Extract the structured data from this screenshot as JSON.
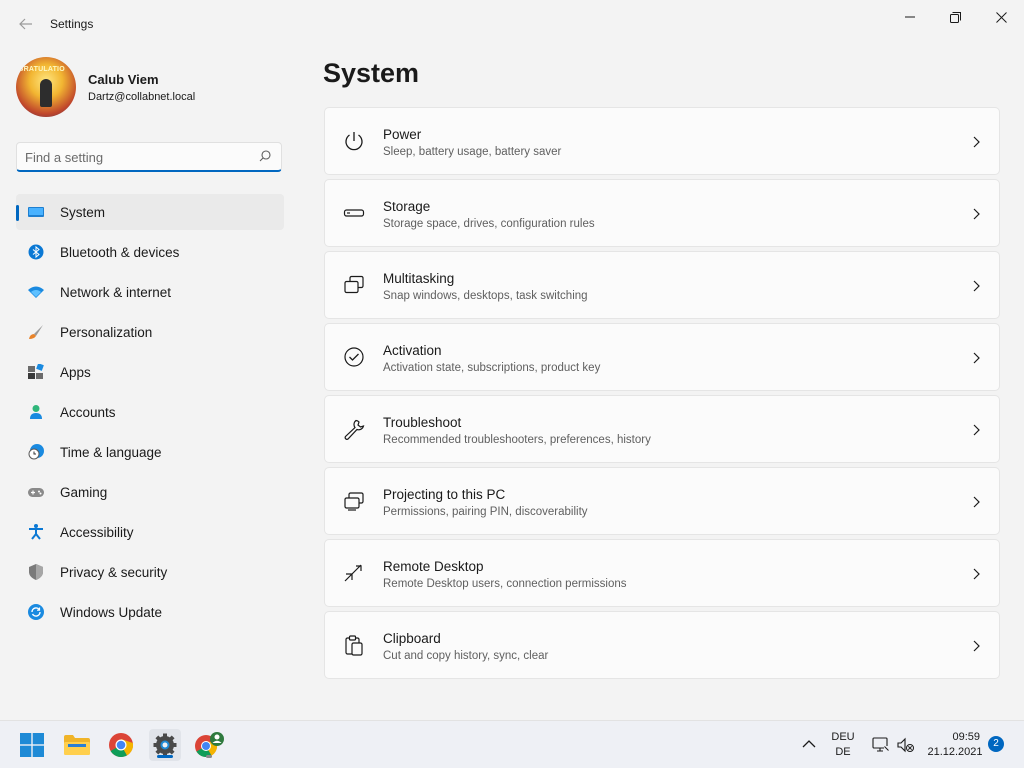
{
  "window": {
    "app_title": "Settings"
  },
  "profile": {
    "name": "Calub Viem",
    "email": "Dartz@collabnet.local",
    "avatar_text": "GRATULATIO"
  },
  "search": {
    "placeholder": "Find a setting",
    "value": ""
  },
  "sidebar": {
    "items": [
      {
        "label": "System",
        "icon": "system-icon",
        "active": true
      },
      {
        "label": "Bluetooth & devices",
        "icon": "bluetooth-icon"
      },
      {
        "label": "Network & internet",
        "icon": "wifi-icon"
      },
      {
        "label": "Personalization",
        "icon": "brush-icon"
      },
      {
        "label": "Apps",
        "icon": "apps-icon"
      },
      {
        "label": "Accounts",
        "icon": "person-icon"
      },
      {
        "label": "Time & language",
        "icon": "clock-globe-icon"
      },
      {
        "label": "Gaming",
        "icon": "gamepad-icon"
      },
      {
        "label": "Accessibility",
        "icon": "accessibility-icon"
      },
      {
        "label": "Privacy & security",
        "icon": "shield-icon"
      },
      {
        "label": "Windows Update",
        "icon": "update-icon"
      }
    ]
  },
  "main": {
    "title": "System",
    "cards": [
      {
        "title": "Power",
        "subtitle": "Sleep, battery usage, battery saver",
        "icon": "power-icon"
      },
      {
        "title": "Storage",
        "subtitle": "Storage space, drives, configuration rules",
        "icon": "storage-icon"
      },
      {
        "title": "Multitasking",
        "subtitle": "Snap windows, desktops, task switching",
        "icon": "multitasking-icon"
      },
      {
        "title": "Activation",
        "subtitle": "Activation state, subscriptions, product key",
        "icon": "activation-check-icon"
      },
      {
        "title": "Troubleshoot",
        "subtitle": "Recommended troubleshooters, preferences, history",
        "icon": "wrench-icon"
      },
      {
        "title": "Projecting to this PC",
        "subtitle": "Permissions, pairing PIN, discoverability",
        "icon": "projecting-icon"
      },
      {
        "title": "Remote Desktop",
        "subtitle": "Remote Desktop users, connection permissions",
        "icon": "remote-desktop-icon"
      },
      {
        "title": "Clipboard",
        "subtitle": "Cut and copy history, sync, clear",
        "icon": "clipboard-icon"
      }
    ]
  },
  "taskbar": {
    "apps": [
      {
        "name": "start",
        "icon": "windows-start-icon"
      },
      {
        "name": "file-explorer",
        "icon": "folder-icon"
      },
      {
        "name": "chrome",
        "icon": "chrome-icon"
      },
      {
        "name": "settings",
        "icon": "settings-gear-icon",
        "active": true
      },
      {
        "name": "chrome-profile",
        "icon": "chrome-profile-icon"
      }
    ],
    "language_line1": "DEU",
    "language_line2": "DE",
    "time": "09:59",
    "date": "21.12.2021",
    "notification_count": "2"
  },
  "colors": {
    "accent": "#0067c0",
    "window_bg": "#f3f3f3",
    "card_bg": "#fbfbfb"
  }
}
